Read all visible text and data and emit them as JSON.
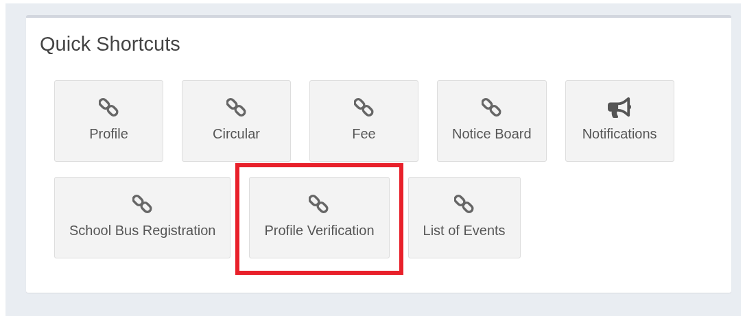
{
  "title": "Quick Shortcuts",
  "shortcuts": [
    [
      {
        "label": "Profile",
        "kind": "link",
        "highlighted": false
      },
      {
        "label": "Circular",
        "kind": "link",
        "highlighted": false
      },
      {
        "label": "Fee",
        "kind": "link",
        "highlighted": false
      },
      {
        "label": "Notice Board",
        "kind": "link",
        "highlighted": false
      },
      {
        "label": "Notifications",
        "kind": "bullhorn",
        "highlighted": false
      }
    ],
    [
      {
        "label": "School Bus Registration",
        "kind": "link",
        "highlighted": false
      },
      {
        "label": "Profile Verification",
        "kind": "link",
        "highlighted": true
      },
      {
        "label": "List of Events",
        "kind": "link",
        "highlighted": false
      }
    ]
  ]
}
